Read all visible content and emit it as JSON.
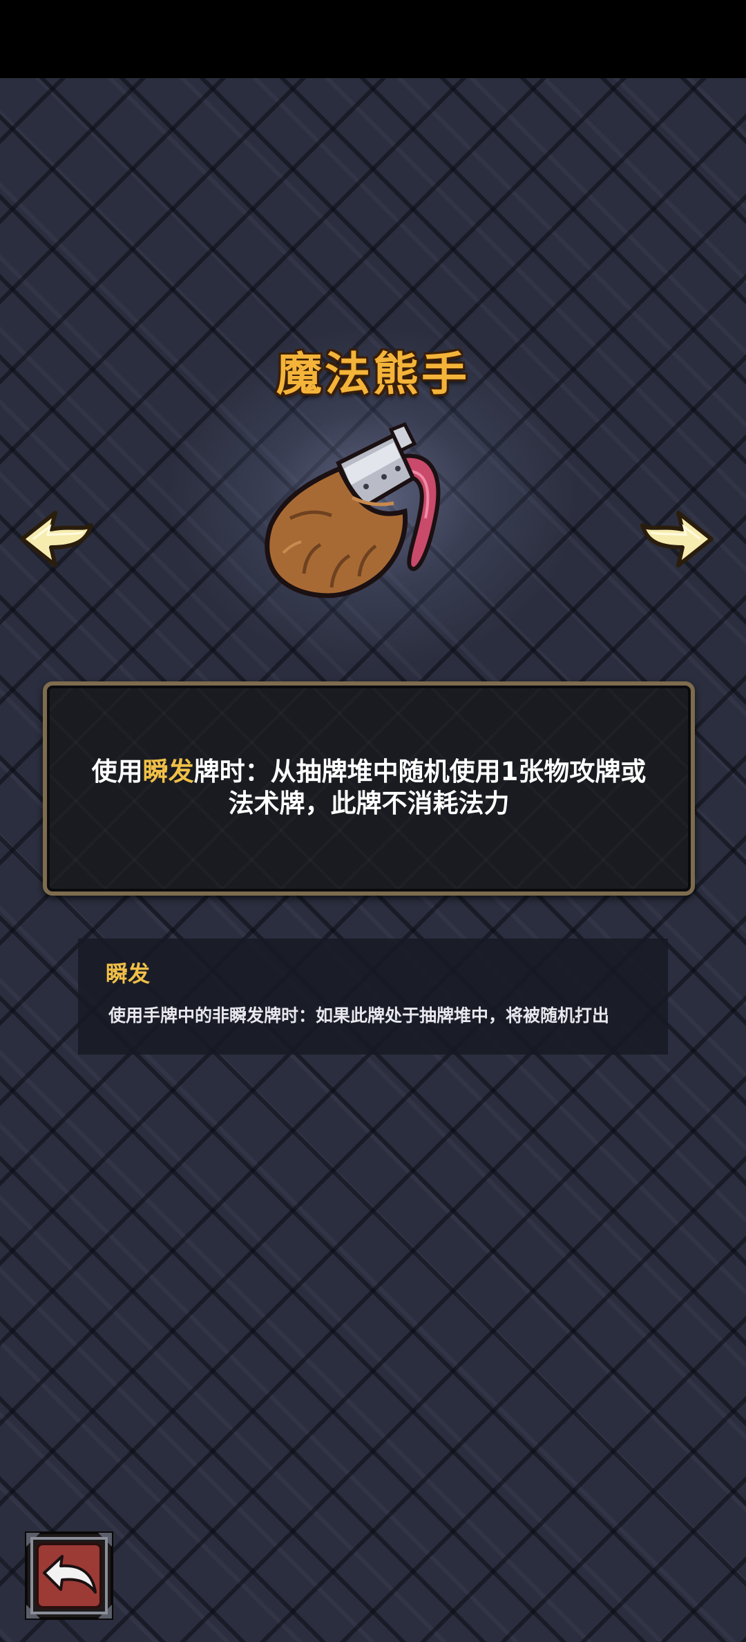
{
  "item": {
    "name": "魔法熊手",
    "art_icon": "bear-paw-glove-icon"
  },
  "description": {
    "prefix": "使用",
    "keyword": "瞬发",
    "suffix_line1": "牌时：从抽牌堆中随机使用1张物攻牌或",
    "line2": "法术牌，此牌不消耗法力",
    "keyword_color": "#f2c048"
  },
  "keyword_tooltip": {
    "title": "瞬发",
    "text": "使用手牌中的非瞬发牌时：如果此牌处于抽牌堆中，将被随机打出"
  },
  "navigation": {
    "prev_icon": "left-arrow-icon",
    "next_icon": "right-arrow-icon",
    "back_icon": "back-return-icon"
  },
  "colors": {
    "title": "#f4b43a",
    "panel_border": "#7e6c4e",
    "background": "#2b2e3e",
    "arrow": "#f7ecb0",
    "back_button": "#9c3a36"
  }
}
